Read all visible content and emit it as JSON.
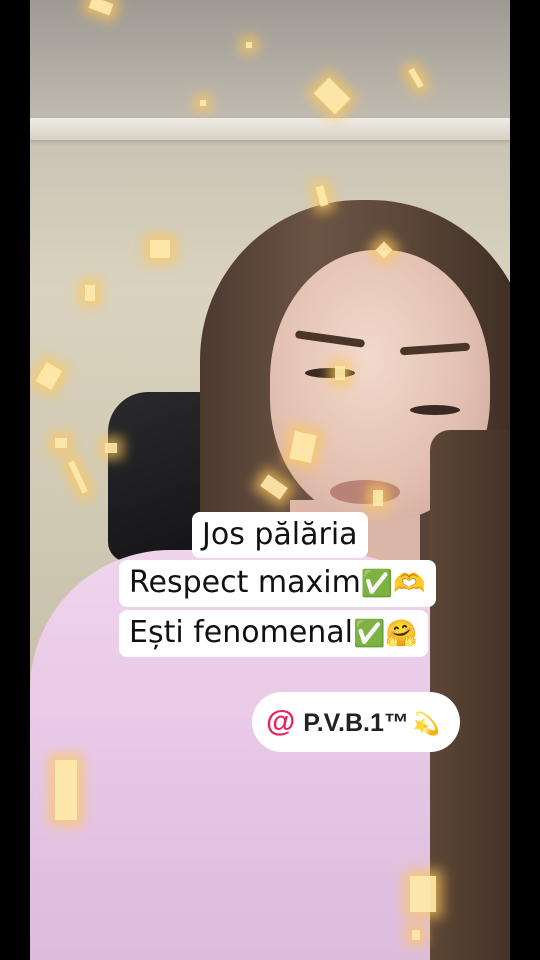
{
  "captions": [
    {
      "text": "Jos pălăria",
      "emoji": ""
    },
    {
      "text": "Respect maxim",
      "emoji": "✅🫶"
    },
    {
      "text": "Ești fenomenal",
      "emoji": "✅🤗"
    }
  ],
  "mention": {
    "at": "@",
    "handle": "P.V.B.1™",
    "emoji": "💫"
  },
  "colors": {
    "mention_at": "#e8235b",
    "caption_bg": "#ffffff",
    "sweater": "#e7c7e6",
    "sparkle": "#ffe9a8"
  }
}
